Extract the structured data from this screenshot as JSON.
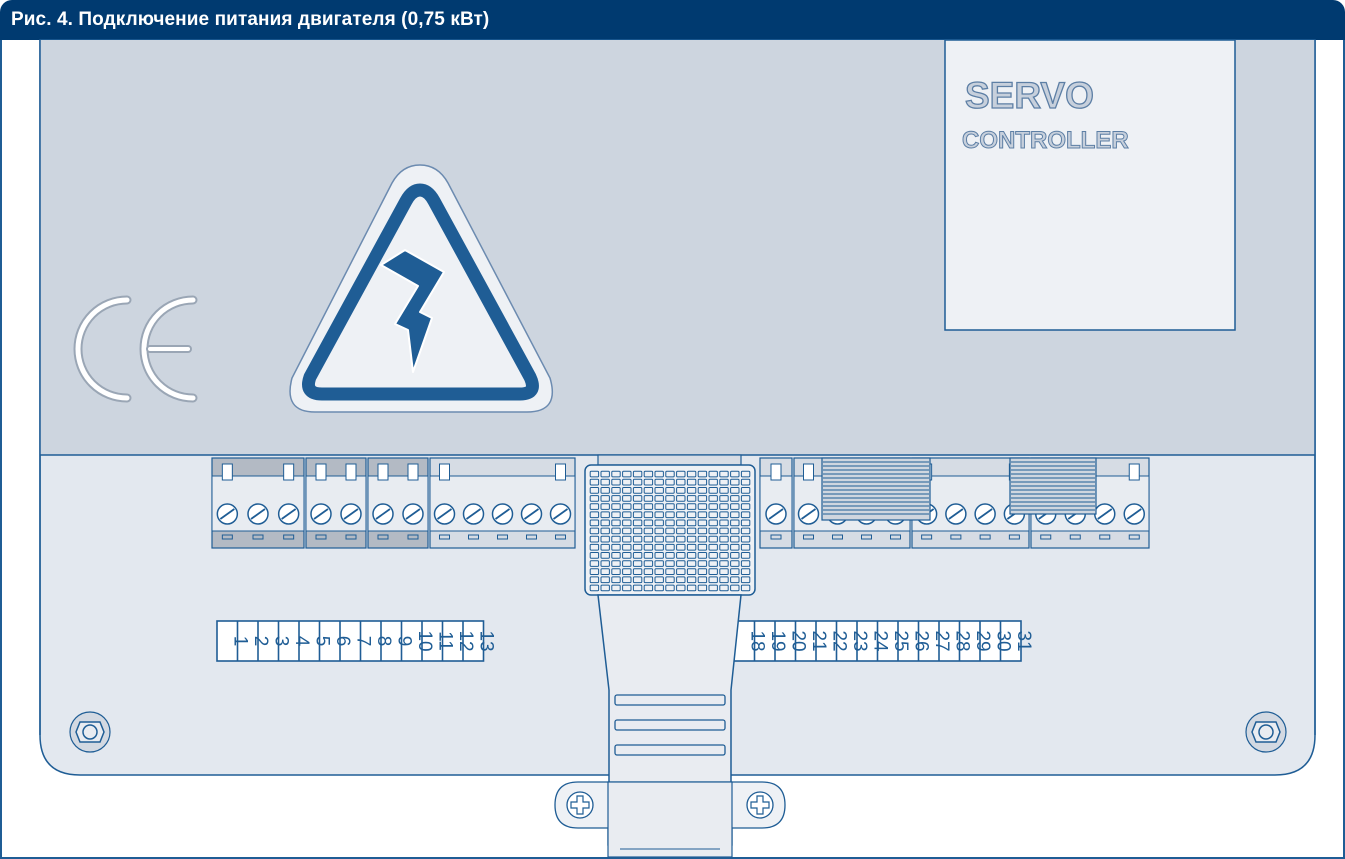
{
  "figure": {
    "title": "Рис. 4. Подключение питания двигателя (0,75 кВт)"
  },
  "device": {
    "label_line1": "SERVO",
    "label_line2": "CONTROLLER",
    "ce_mark": "CE",
    "warning_symbol": "high-voltage-warning-triangle"
  },
  "terminals": {
    "numbers": [
      "1",
      "2",
      "3",
      "4",
      "5",
      "6",
      "7",
      "8",
      "9",
      "10",
      "11",
      "12",
      "13",
      "18",
      "19",
      "20",
      "21",
      "22",
      "23",
      "24",
      "25",
      "26",
      "27",
      "28",
      "29",
      "30",
      "31"
    ]
  },
  "colors": {
    "header_bg": "#003a70",
    "outline": "#1f5d95",
    "panel_upper": "#cdd5df",
    "panel_lower": "#e3e8ef",
    "terminal_block": "#b3bac4",
    "terminal_highlight": "#e8ecf1",
    "connector_fill": "#e9ecf1"
  }
}
